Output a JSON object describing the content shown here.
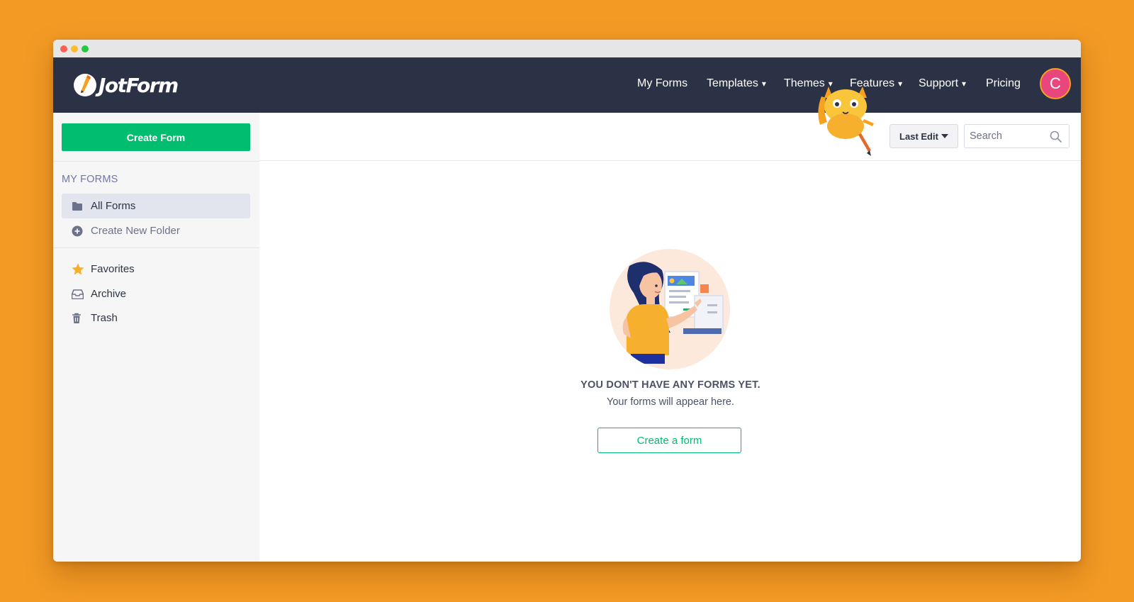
{
  "window": {
    "traffic_lights": [
      "close",
      "minimize",
      "zoom"
    ]
  },
  "navbar": {
    "logo_text": "JotForm",
    "items": [
      {
        "label": "My Forms",
        "has_caret": false
      },
      {
        "label": "Templates",
        "has_caret": true
      },
      {
        "label": "Themes",
        "has_caret": true
      },
      {
        "label": "Features",
        "has_caret": true
      },
      {
        "label": "Support",
        "has_caret": true
      },
      {
        "label": "Pricing",
        "has_caret": false
      }
    ],
    "caret": "▾",
    "avatar_initial": "C",
    "colors": {
      "background": "#2B3245",
      "avatar": "#E8467C",
      "avatar_ring": "#F6A21E"
    }
  },
  "sidebar": {
    "create_button": "Create Form",
    "section_heading": "MY FORMS",
    "folders": [
      {
        "label": "All Forms",
        "icon": "folder-icon",
        "active": true
      },
      {
        "label": "Create New Folder",
        "icon": "plus-circle-icon",
        "active": false
      }
    ],
    "items": [
      {
        "label": "Favorites",
        "icon": "star-icon"
      },
      {
        "label": "Archive",
        "icon": "inbox-icon"
      },
      {
        "label": "Trash",
        "icon": "trash-icon"
      }
    ],
    "colors": {
      "primary": "#01BD6F",
      "star": "#F6B02E"
    }
  },
  "toolbar": {
    "sort_label": "Last Edit",
    "search_placeholder": "Search"
  },
  "empty_state": {
    "title": "YOU DON'T HAVE ANY FORMS YET.",
    "subtitle": "Your forms will appear here.",
    "button": "Create a form"
  },
  "colors": {
    "background": "#F39A24",
    "accent": "#01BD6F"
  }
}
